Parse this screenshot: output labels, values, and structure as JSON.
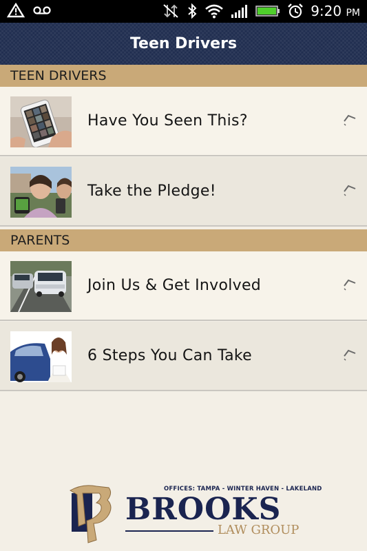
{
  "status_bar": {
    "time": "9:20",
    "ampm": "PM",
    "icons": [
      "warning-icon",
      "voicemail-icon",
      "data-off-icon",
      "bluetooth-icon",
      "wifi-icon",
      "signal-icon",
      "battery-icon",
      "alarm-icon"
    ]
  },
  "header": {
    "title": "Teen Drivers"
  },
  "sections": [
    {
      "title": "TEEN DRIVERS",
      "items": [
        {
          "label": "Have You Seen This?"
        },
        {
          "label": "Take the Pledge!"
        }
      ]
    },
    {
      "title": "PARENTS",
      "items": [
        {
          "label": "Join Us & Get Involved"
        },
        {
          "label": "6 Steps You Can Take"
        }
      ]
    }
  ],
  "logo": {
    "offices": "OFFICES: TAMPA - WINTER HAVEN - LAKELAND",
    "name": "BROOKS",
    "subtitle": "LAW GROUP"
  },
  "colors": {
    "header_bg": "#1f2d4f",
    "section_bg": "#c9a978",
    "brand_navy": "#1a2450",
    "brand_gold": "#b08d5c"
  }
}
